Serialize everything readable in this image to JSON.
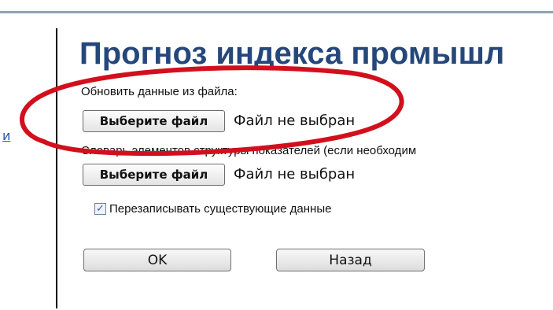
{
  "page": {
    "title": "Прогноз индекса промышл",
    "left_link": "и"
  },
  "form": {
    "file_label": "Обновить данные из файла:",
    "dict_label": "Словарь элементов структуры показателей (если необходим",
    "file_button": "Выберите файл",
    "file_status": "Файл не выбран",
    "overwrite_label": "Перезаписывать существующие данные",
    "overwrite_checked": true,
    "checkmark": "✓",
    "ok_button": "OK",
    "back_button": "Назад"
  },
  "colors": {
    "title": "#25477a",
    "annotation": "#d2101d",
    "link": "#2b55b3"
  }
}
